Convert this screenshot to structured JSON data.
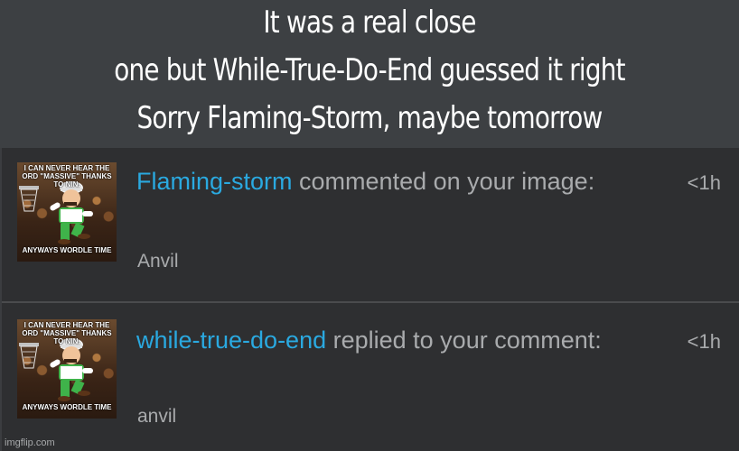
{
  "caption": {
    "line1": "It was a real close",
    "line2": "one but While-True-Do-End guessed it right",
    "line3": "Sorry Flaming-Storm, maybe tomorrow"
  },
  "notifications": [
    {
      "username": "Flaming-storm",
      "action": " commented on your image:",
      "body": "Anvil",
      "time": "<1h",
      "avatar": {
        "top_text": "I CAN NEVER HEAR THE ORD \"MASSIVE\" THANKS TO NIN.",
        "bottom_text": "ANYWAYS WORDLE TIME"
      }
    },
    {
      "username": "while-true-do-end",
      "action": " replied to your comment:",
      "body": "anvil",
      "time": "<1h",
      "avatar": {
        "top_text": "I CAN NEVER HEAR THE ORD \"MASSIVE\" THANKS TO NIN.",
        "bottom_text": "ANYWAYS WORDLE TIME"
      }
    }
  ],
  "watermark": "imgflip.com",
  "colors": {
    "username": "#2aa9e0",
    "text": "#a9abad",
    "panel": "#2e2f31",
    "caption_bg": "#3d4043"
  }
}
